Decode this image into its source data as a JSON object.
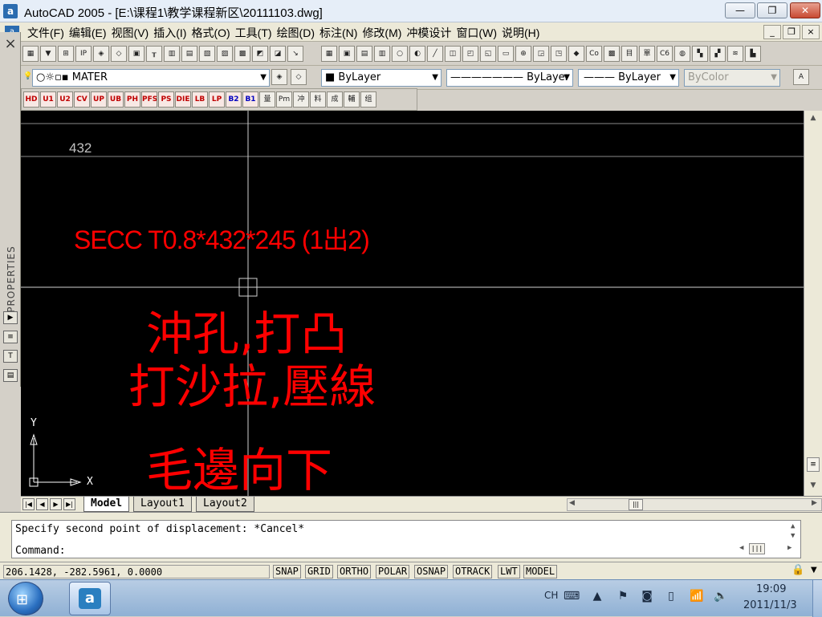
{
  "window": {
    "title": "AutoCAD 2005 - [E:\\课程1\\教学课程新区\\20111103.dwg]",
    "app_icon_glyph": "a",
    "minimize_glyph": "—",
    "maximize_glyph": "❐",
    "close_glyph": "✕"
  },
  "menu": {
    "items": [
      "文件(F)",
      "编辑(E)",
      "视图(V)",
      "插入(I)",
      "格式(O)",
      "工具(T)",
      "绘图(D)",
      "标注(N)",
      "修改(M)",
      "冲模设计",
      "窗口(W)",
      "说明(H)"
    ],
    "mdi_minimize": "_",
    "mdi_restore": "❐",
    "mdi_close": "×"
  },
  "properties_palette": {
    "label": "PROPERTIES",
    "close_glyph": "×"
  },
  "toolbar_layers": {
    "layer_name": "MATER",
    "color": "ByLayer",
    "linetype": "ByLayer",
    "lineweight": "ByLayer",
    "plotstyle": "ByColor"
  },
  "custom_toolbar": {
    "buttons": [
      "HD",
      "U1",
      "U2",
      "CV",
      "UP",
      "UB",
      "PH",
      "PFS",
      "PS",
      "DIE",
      "LB",
      "LP",
      "B2",
      "B1",
      "量",
      "Pm",
      "冲",
      "料",
      "成",
      "輔",
      "组"
    ]
  },
  "drawing": {
    "dimension_text": "432",
    "spec_text": "SECC T0.8*432*245 (1出2)",
    "note_line1": "沖孔,打凸",
    "note_line2": "打沙拉,壓線",
    "note_line3": "毛邊向下",
    "ucs_x": "X",
    "ucs_y": "Y",
    "colors": {
      "background": "#000000",
      "red_text": "#ff0000",
      "dim_text": "#c0c0c0"
    }
  },
  "layout_tabs": [
    "Model",
    "Layout1",
    "Layout2"
  ],
  "command": {
    "history": "Specify second point of displacement: *Cancel*",
    "prompt": "Command:"
  },
  "status": {
    "coordinates": "206.1428, -282.5961, 0.0000",
    "toggles": [
      "SNAP",
      "GRID",
      "ORTHO",
      "POLAR",
      "OSNAP",
      "OTRACK",
      "LWT",
      "MODEL"
    ]
  },
  "taskbar": {
    "language": "CH",
    "time": "19:09",
    "date": "2011/11/3"
  }
}
